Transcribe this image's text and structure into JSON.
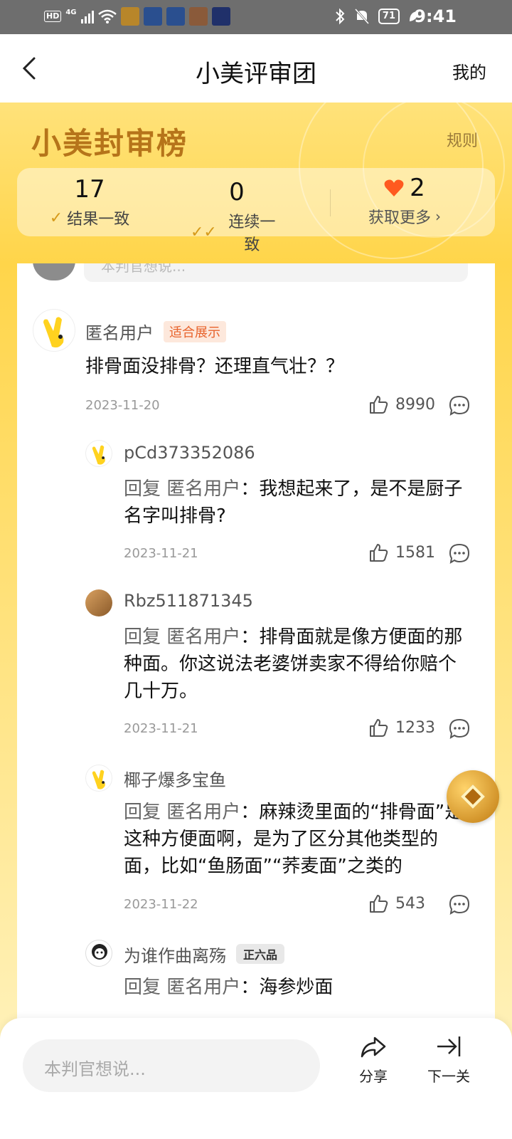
{
  "status_bar": {
    "hd": "HD",
    "network": "4G",
    "battery": "71",
    "time": "9:41"
  },
  "header": {
    "title": "小美评审团",
    "right_link": "我的"
  },
  "board": {
    "title": "小美封审榜",
    "rules": "规则",
    "stats": [
      {
        "value": "17",
        "label": "结果一致"
      },
      {
        "value": "0",
        "label": "连续一致"
      },
      {
        "value": "2",
        "label": "获取更多"
      }
    ]
  },
  "peek_input": {
    "placeholder": "本判官想说..."
  },
  "comment": {
    "user": "匿名用户",
    "tag": "适合展示",
    "text": "排骨面没排骨？还理直气壮？？",
    "date": "2023-11-20",
    "likes": "8990"
  },
  "replies": [
    {
      "user": "pCd373352086",
      "prefix": "回复",
      "to": "匿名用户",
      "text": "我想起来了，是不是厨子名字叫排骨?",
      "date": "2023-11-21",
      "likes": "1581"
    },
    {
      "user": "Rbz511871345",
      "prefix": "回复",
      "to": "匿名用户",
      "text": "排骨面就是像方便面的那种面。你这说法老婆饼卖家不得给你赔个几十万。",
      "date": "2023-11-21",
      "likes": "1233"
    },
    {
      "user": "椰子爆多宝鱼",
      "prefix": "回复",
      "to": "匿名用户",
      "text": "麻辣烫里面的“排骨面”是这种方便面啊，是为了区分其他类型的面，比如“鱼肠面”“荞麦面”之类的",
      "date": "2023-11-22",
      "likes": "543"
    },
    {
      "user": "为谁作曲离殇",
      "badge": "正六品",
      "prefix": "回复",
      "to": "匿名用户",
      "text": "海参炒面"
    }
  ],
  "bottom_bar": {
    "input_placeholder": "本判官想说...",
    "share": "分享",
    "next": "下一关"
  },
  "colors": {
    "brand_yellow": "#ffd54a",
    "title_brown": "#b6741a",
    "heart": "#ff5a1f",
    "tag_orange": "#e8632c"
  }
}
